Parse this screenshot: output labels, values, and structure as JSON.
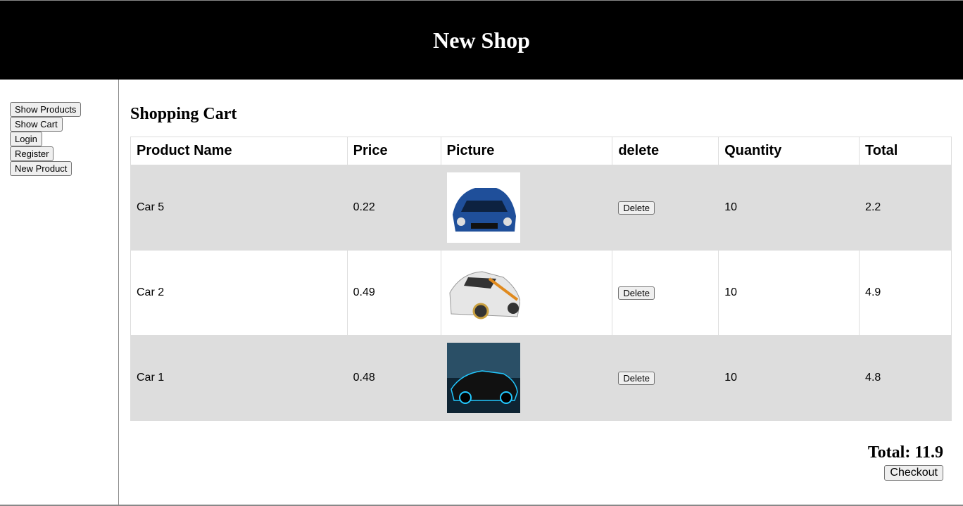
{
  "header": {
    "title": "New Shop"
  },
  "sidebar": {
    "items": [
      {
        "label": "Show Products"
      },
      {
        "label": "Show Cart"
      },
      {
        "label": "Login"
      },
      {
        "label": "Register"
      },
      {
        "label": "New Product"
      }
    ]
  },
  "cart": {
    "title": "Shopping Cart",
    "columns": [
      "Product Name",
      "Price",
      "Picture",
      "delete",
      "Quantity",
      "Total"
    ],
    "rows": [
      {
        "name": "Car 5",
        "price": "0.22",
        "picture": "blue-sports-car",
        "delete": "Delete",
        "quantity": "10",
        "total": "2.2"
      },
      {
        "name": "Car 2",
        "price": "0.49",
        "picture": "white-sports-car",
        "delete": "Delete",
        "quantity": "10",
        "total": "4.9"
      },
      {
        "name": "Car 1",
        "price": "0.48",
        "picture": "dark-neon-car",
        "delete": "Delete",
        "quantity": "10",
        "total": "4.8"
      }
    ],
    "total_label": "Total: 11.9",
    "checkout": "Checkout"
  }
}
